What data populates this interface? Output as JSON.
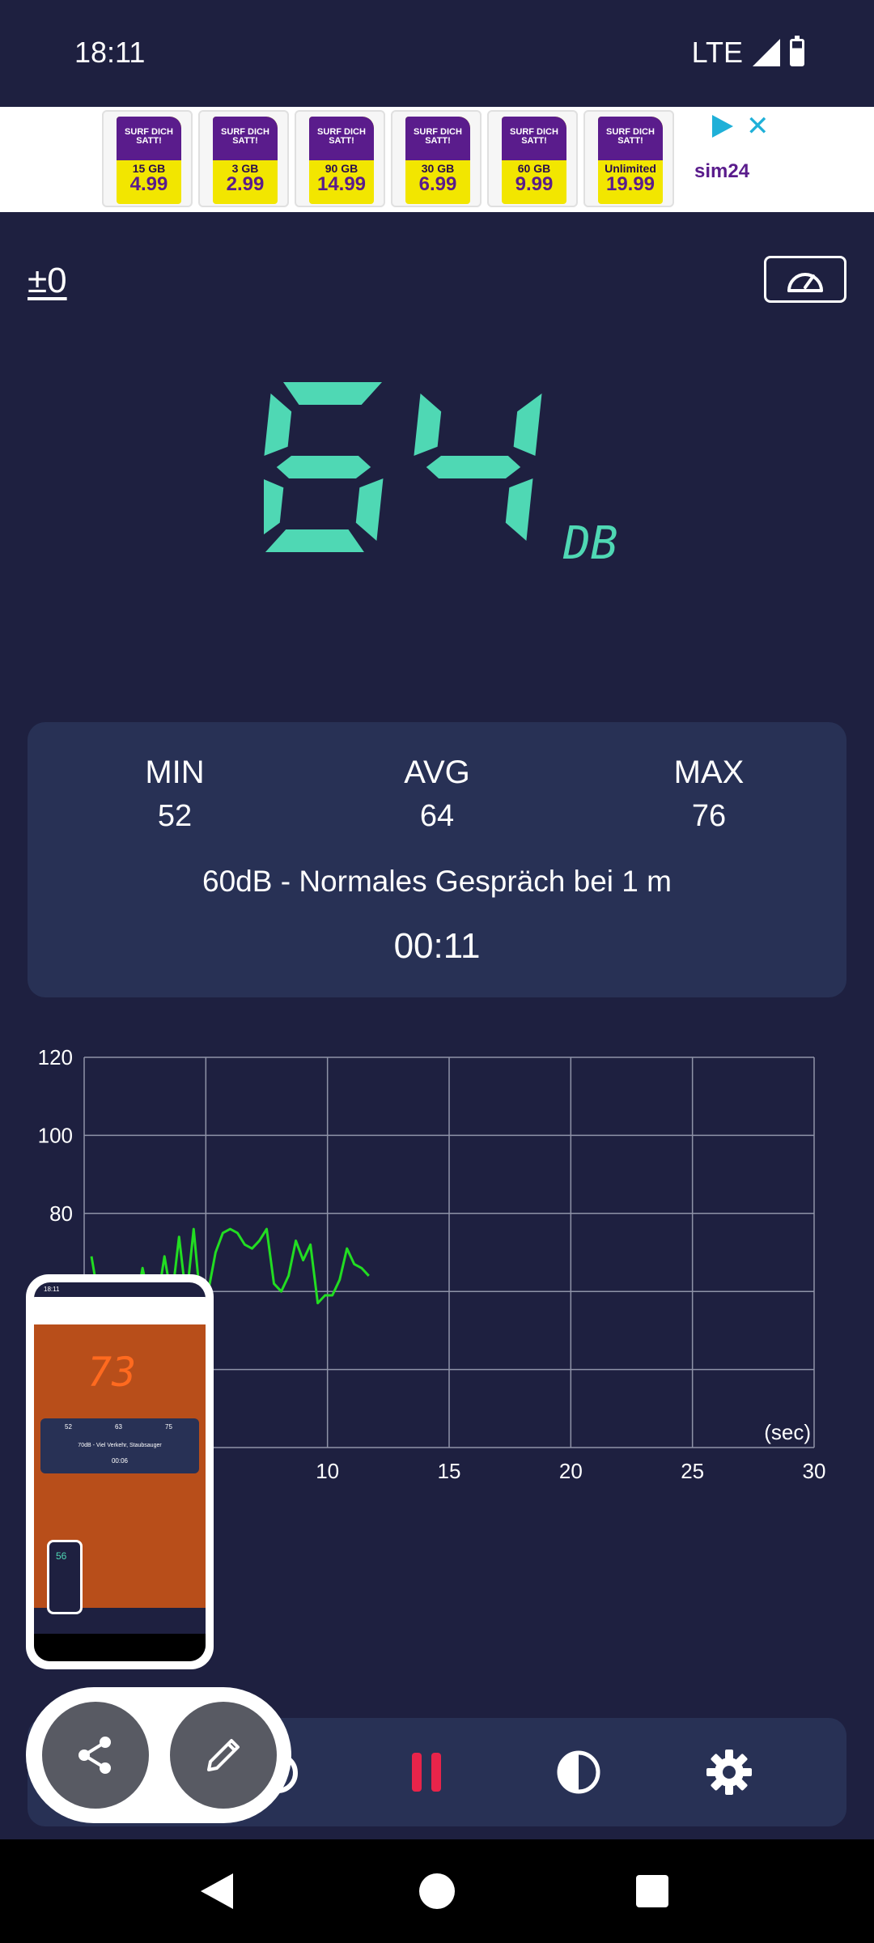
{
  "status_bar": {
    "time": "18:11",
    "network": "LTE"
  },
  "ad": {
    "cards": [
      {
        "headline": "SURF DICH SATT!",
        "data": "15 GB",
        "price": "4.99"
      },
      {
        "headline": "SURF DICH SATT!",
        "data": "3 GB",
        "price": "2.99"
      },
      {
        "headline": "SURF DICH SATT!",
        "data": "90 GB",
        "price": "14.99"
      },
      {
        "headline": "SURF DICH SATT!",
        "data": "30 GB",
        "price": "6.99"
      },
      {
        "headline": "SURF DICH SATT!",
        "data": "60 GB",
        "price": "9.99"
      },
      {
        "headline": "SURF DICH SATT!",
        "data": "Unlimited",
        "price": "19.99"
      }
    ],
    "brand": "sim24"
  },
  "header": {
    "offset": "±0"
  },
  "reading": {
    "value": "64",
    "unit": "DB",
    "color": "#4fd8b4"
  },
  "stats": {
    "min_label": "MIN",
    "min_value": "52",
    "avg_label": "AVG",
    "avg_value": "64",
    "max_label": "MAX",
    "max_value": "76",
    "description": "60dB - Normales Gespräch bei 1 m",
    "elapsed": "00:11"
  },
  "mini_preview": {
    "time": "18:11",
    "reading": "73",
    "min": "52",
    "avg": "63",
    "max": "75",
    "description": "70dB - Viel Verkehr, Staubsauger",
    "elapsed": "00:06",
    "inner_reading": "56"
  },
  "chart_data": {
    "type": "line",
    "x_unit_label": "(sec)",
    "xlim": [
      0,
      30
    ],
    "ylim": [
      20,
      120
    ],
    "x_ticks": [
      10,
      15,
      20,
      25,
      30
    ],
    "y_ticks": [
      60,
      80,
      100,
      120
    ],
    "grid": true,
    "series": [
      {
        "color": "#22dd22",
        "x": [
          0.3,
          0.6,
          0.9,
          1.2,
          1.5,
          1.8,
          2.1,
          2.4,
          2.7,
          3.0,
          3.3,
          3.6,
          3.9,
          4.2,
          4.5,
          4.8,
          5.1,
          5.4,
          5.7,
          6.0,
          6.3,
          6.6,
          6.9,
          7.2,
          7.5,
          7.8,
          8.1,
          8.4,
          8.7,
          9.0,
          9.3,
          9.6,
          9.9,
          10.2,
          10.5,
          10.8,
          11.1,
          11.4,
          11.7
        ],
        "y": [
          69,
          58,
          63,
          57,
          56,
          55,
          56,
          66,
          57,
          57,
          69,
          58,
          74,
          58,
          76,
          56,
          60,
          70,
          75,
          76,
          75,
          72,
          71,
          73,
          76,
          62,
          60,
          64,
          73,
          68,
          72,
          57,
          59,
          59,
          63,
          71,
          67,
          66,
          64
        ]
      }
    ]
  },
  "actions": {
    "share": "share",
    "edit": "edit"
  }
}
